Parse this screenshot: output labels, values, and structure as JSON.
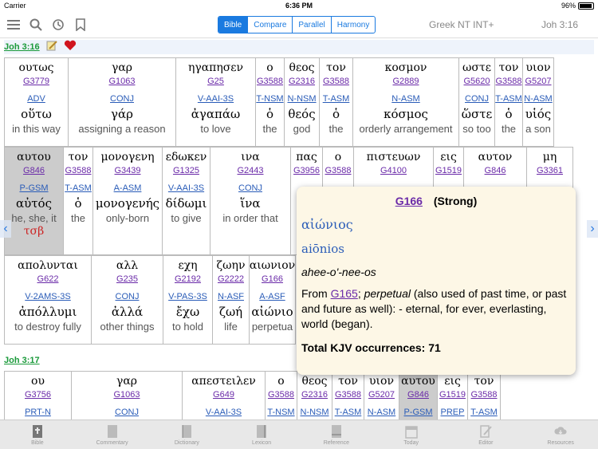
{
  "status": {
    "carrier": "Carrier",
    "time": "6:36 PM",
    "battery": "96%",
    "battery_level": 0.96
  },
  "toolbar": {
    "segments": [
      "Bible",
      "Compare",
      "Parallel",
      "Harmony"
    ],
    "active_segment": "Bible",
    "module": "Greek NT INT+",
    "reference": "Joh 3:16"
  },
  "verse1": {
    "ref": "Joh 3:16",
    "row1": [
      {
        "g": "ουτως",
        "s": "G3779",
        "m": "ADV",
        "l": "οὕτω",
        "e": "in this way"
      },
      {
        "g": "γαρ",
        "s": "G1063",
        "m": "CONJ",
        "l": "γάρ",
        "e": "assigning a reason"
      },
      {
        "g": "ηγαπησεν",
        "s": "G25",
        "m": "V-AAI-3S",
        "l": "ἀγαπάω",
        "e": "to love"
      },
      {
        "g": "ο",
        "s": "G3588",
        "m": "T-NSM",
        "l": "ὁ",
        "e": "the"
      },
      {
        "g": "θεος",
        "s": "G2316",
        "m": "N-NSM",
        "l": "θεός",
        "e": "god"
      },
      {
        "g": "τον",
        "s": "G3588",
        "m": "T-ASM",
        "l": "ὁ",
        "e": "the"
      },
      {
        "g": "κοσμον",
        "s": "G2889",
        "m": "N-ASM",
        "l": "κόσμος",
        "e": "orderly arrangement"
      },
      {
        "g": "ωστε",
        "s": "G5620",
        "m": "CONJ",
        "l": "ὥστε",
        "e": "so too"
      },
      {
        "g": "τον",
        "s": "G3588",
        "m": "T-ASM",
        "l": "ὁ",
        "e": "the"
      },
      {
        "g": "υιον",
        "s": "G5207",
        "m": "N-ASM",
        "l": "υἱός",
        "e": "a son"
      }
    ],
    "row2": [
      {
        "g": "αυτου",
        "s": "G846",
        "m": "P-GSM",
        "l": "αὐτός",
        "e": "he, she, it",
        "heb": "τσβ"
      },
      {
        "g": "τον",
        "s": "G3588",
        "m": "T-ASM",
        "l": "ὁ",
        "e": "the"
      },
      {
        "g": "μονογενη",
        "s": "G3439",
        "m": "A-ASM",
        "l": "μονογενής",
        "e": "only-born"
      },
      {
        "g": "εδωκεν",
        "s": "G1325",
        "m": "V-AAI-3S",
        "l": "δίδωμι",
        "e": "to give"
      },
      {
        "g": "ινα",
        "s": "G2443",
        "m": "CONJ",
        "l": "ἵνα",
        "e": "in order that"
      },
      {
        "g": "πας",
        "s": "G3956",
        "m": "",
        "l": "",
        "e": ""
      },
      {
        "g": "ο",
        "s": "G3588",
        "m": "",
        "l": "",
        "e": ""
      },
      {
        "g": "πιστευων",
        "s": "G4100",
        "m": "",
        "l": "",
        "e": ""
      },
      {
        "g": "εις",
        "s": "G1519",
        "m": "",
        "l": "",
        "e": ""
      },
      {
        "g": "αυτον",
        "s": "G846",
        "m": "",
        "l": "",
        "e": ""
      },
      {
        "g": "μη",
        "s": "G3361",
        "m": "",
        "l": "",
        "e": ""
      }
    ],
    "row3": [
      {
        "g": "απολυνται",
        "s": "G622",
        "m": "V-2AMS-3S",
        "l": "ἀπόλλυμι",
        "e": "to destroy fully"
      },
      {
        "g": "αλλ",
        "s": "G235",
        "m": "CONJ",
        "l": "ἀλλά",
        "e": "other things"
      },
      {
        "g": "εχη",
        "s": "G2192",
        "m": "V-PAS-3S",
        "l": "ἔχω",
        "e": "to hold"
      },
      {
        "g": "ζωην",
        "s": "G2222",
        "m": "N-ASF",
        "l": "ζωή",
        "e": "life"
      },
      {
        "g": "αιωνιον",
        "s": "G166",
        "m": "A-ASF",
        "l": "αἰώνιο",
        "e": "perpetua"
      }
    ]
  },
  "verse2": {
    "ref": "Joh 3:17",
    "row1": [
      {
        "g": "ου",
        "s": "G3756",
        "m": "PRT-N"
      },
      {
        "g": "γαρ",
        "s": "G1063",
        "m": "CONJ"
      },
      {
        "g": "απεστειλεν",
        "s": "G649",
        "m": "V-AAI-3S"
      },
      {
        "g": "ο",
        "s": "G3588",
        "m": "T-NSM"
      },
      {
        "g": "θεος",
        "s": "G2316",
        "m": "N-NSM"
      },
      {
        "g": "τον",
        "s": "G3588",
        "m": "T-ASM"
      },
      {
        "g": "υιον",
        "s": "G5207",
        "m": "N-ASM"
      },
      {
        "g": "αυτου",
        "s": "G846",
        "m": "P-GSM"
      },
      {
        "g": "εις",
        "s": "G1519",
        "m": "PREP"
      },
      {
        "g": "τον",
        "s": "G3588",
        "m": "T-ASM"
      }
    ]
  },
  "popup": {
    "number": "G166",
    "source": "(Strong)",
    "word": "αἰώνιος",
    "translit": "aiōnios",
    "pron": "ahee-o'-nee-os",
    "def_prefix": "From ",
    "def_link": "G165",
    "def_sep": "; ",
    "def_italic": "perpetual",
    "def_rest": " (also used of past time, or past and future as well): - eternal, for ever, everlasting, world (began).",
    "occurrences": "Total KJV occurrences: 71"
  },
  "tabs": [
    "Bible",
    "Commentary",
    "Dictionary",
    "Lexicon",
    "Reference",
    "Today",
    "Editor",
    "Resources"
  ]
}
